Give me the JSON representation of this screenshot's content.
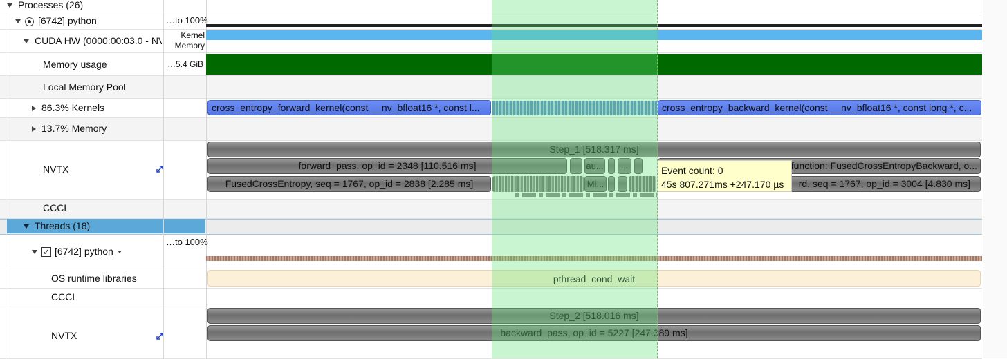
{
  "tree": {
    "processes": "Processes (26)",
    "process": "[6742] python",
    "process_value": "…to 100%",
    "cuda_hw": "CUDA HW (0000:00:03.0 - NV",
    "cuda_col": "Kernel Memory",
    "memory_usage": "Memory usage",
    "memory_value": "…5.4 GiB",
    "local_pool": "Local Memory Pool",
    "kernels": "86.3% Kernels",
    "memory": "13.7% Memory",
    "nvtx": "NVTX",
    "cccl": "CCCL",
    "threads": "Threads (18)",
    "thread": "[6742] python",
    "thread_value": "…to 100%",
    "os_rt": "OS runtime libraries",
    "cccl2": "CCCL",
    "nvtx2": "NVTX"
  },
  "timeline": {
    "kernel_fwd": "cross_entropy_forward_kernel(const __nv_bfloat16 *, const l...",
    "kernel_bwd": "cross_entropy_backward_kernel(const __nv_bfloat16 *, const long *, c...",
    "step1": "Step_1 [518.317 ms]",
    "forward_pass": "forward_pass, op_id = 2348 [110.516 ms]",
    "au": "au...",
    "dots": "...",
    "fused_bwd": "...::evaluate_function: FusedCrossEntropyBackward, o...",
    "fused_fwd": "FusedCrossEntropy, seq = 1767, op_id = 2838 [2.285 ms]",
    "mi": "Mi...",
    "fused_bwd2": "rd, seq = 1767, op_id = 3004 [4.830 ms]",
    "pthread": "pthread_cond_wait",
    "step2": "Step_2 [518.016 ms]",
    "backward_pass": "backward_pass, op_id = 5227 [247.389 ms]"
  },
  "tooltip": {
    "line1": "Event count: 0",
    "line2": "45s 807.271ms +247.170 µs"
  },
  "colors": {
    "selection": "#64e178",
    "memory_bar": "#006400",
    "kernel_blue": "#5c7ff0",
    "threads_header": "#5ca8d8",
    "tooltip_bg": "#ffffcc"
  }
}
